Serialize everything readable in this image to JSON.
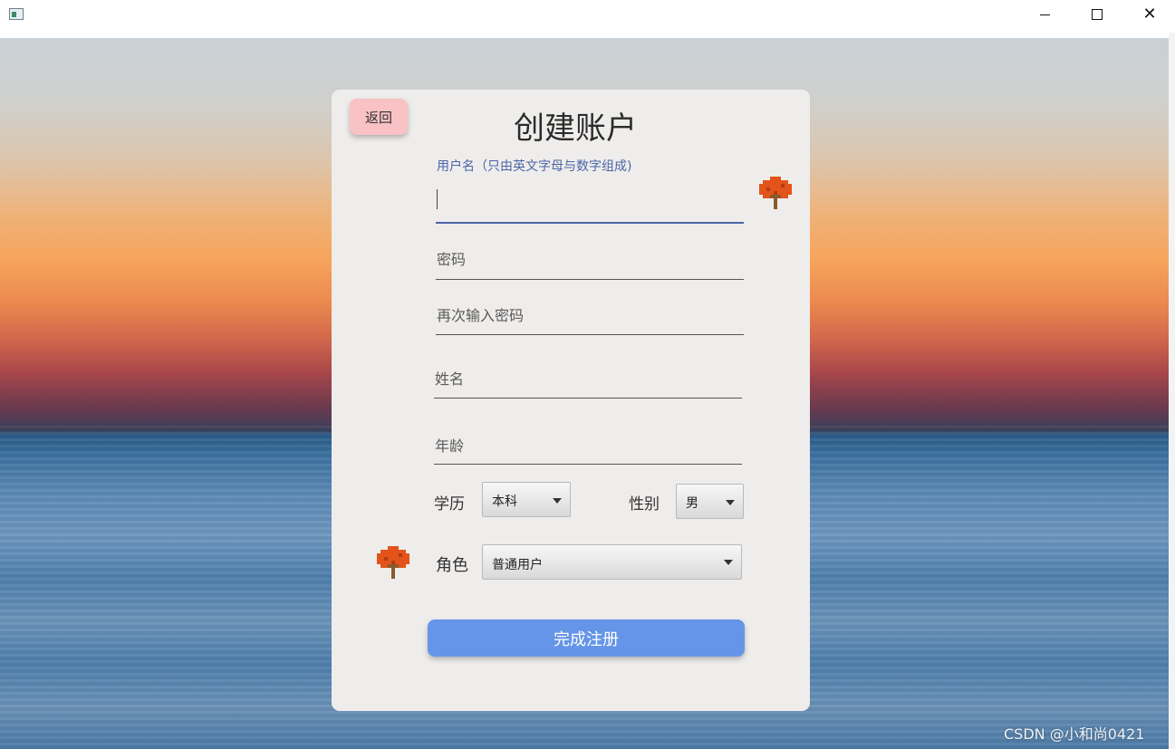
{
  "window": {
    "controls": {
      "minimize_icon": "minimize-icon",
      "maximize_icon": "maximize-icon",
      "close_icon": "close-icon"
    }
  },
  "form": {
    "back_label": "返回",
    "title": "创建账户",
    "username": {
      "label": "用户名（只由英文字母与数字组成)",
      "value": ""
    },
    "password": {
      "placeholder": "密码"
    },
    "confirm_password": {
      "placeholder": "再次输入密码"
    },
    "name": {
      "placeholder": "姓名"
    },
    "age": {
      "placeholder": "年龄"
    },
    "education": {
      "label": "学历",
      "selected": "本科"
    },
    "gender": {
      "label": "性别",
      "selected": "男"
    },
    "role": {
      "label": "角色",
      "selected": "普通用户"
    },
    "submit_label": "完成注册"
  },
  "watermark": "CSDN @小和尚0421",
  "colors": {
    "accent_blue": "#4a65a8",
    "submit_button": "#6595e8",
    "back_button": "#f9c2c5",
    "card_background": "#efedeb",
    "tree_icon": "#e2541a"
  }
}
